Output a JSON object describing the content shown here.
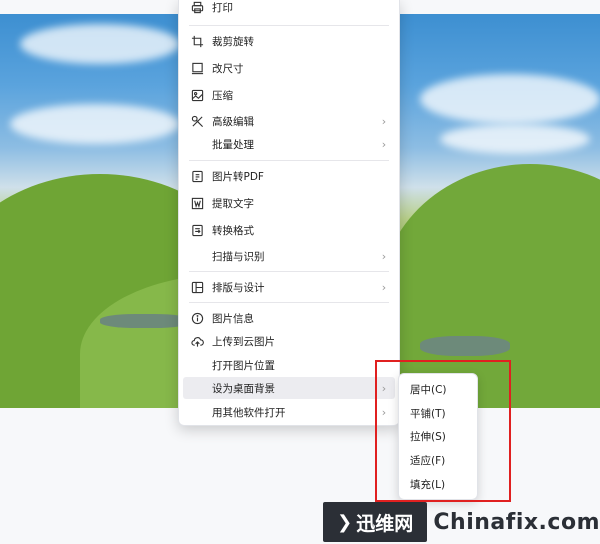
{
  "menu": {
    "print": "打印",
    "crop_rotate": "裁剪旋转",
    "resize": "改尺寸",
    "compress": "压缩",
    "advanced_edit": "高级编辑",
    "batch": "批量处理",
    "to_pdf": "图片转PDF",
    "extract_text": "提取文字",
    "convert_format": "转换格式",
    "scan_recognize": "扫描与识别",
    "layout_design": "排版与设计",
    "image_info": "图片信息",
    "upload_cloud": "上传到云图片",
    "open_location": "打开图片位置",
    "set_wallpaper": "设为桌面背景",
    "open_with": "用其他软件打开"
  },
  "submenu": {
    "center": "居中(C)",
    "tile": "平铺(T)",
    "stretch": "拉伸(S)",
    "fit": "适应(F)",
    "fill": "填充(L)"
  },
  "watermark": {
    "brand": "迅维网",
    "site": "Chinafix.com"
  },
  "colors": {
    "highlight": "#ececf0",
    "annotation_box": "#e02020"
  }
}
